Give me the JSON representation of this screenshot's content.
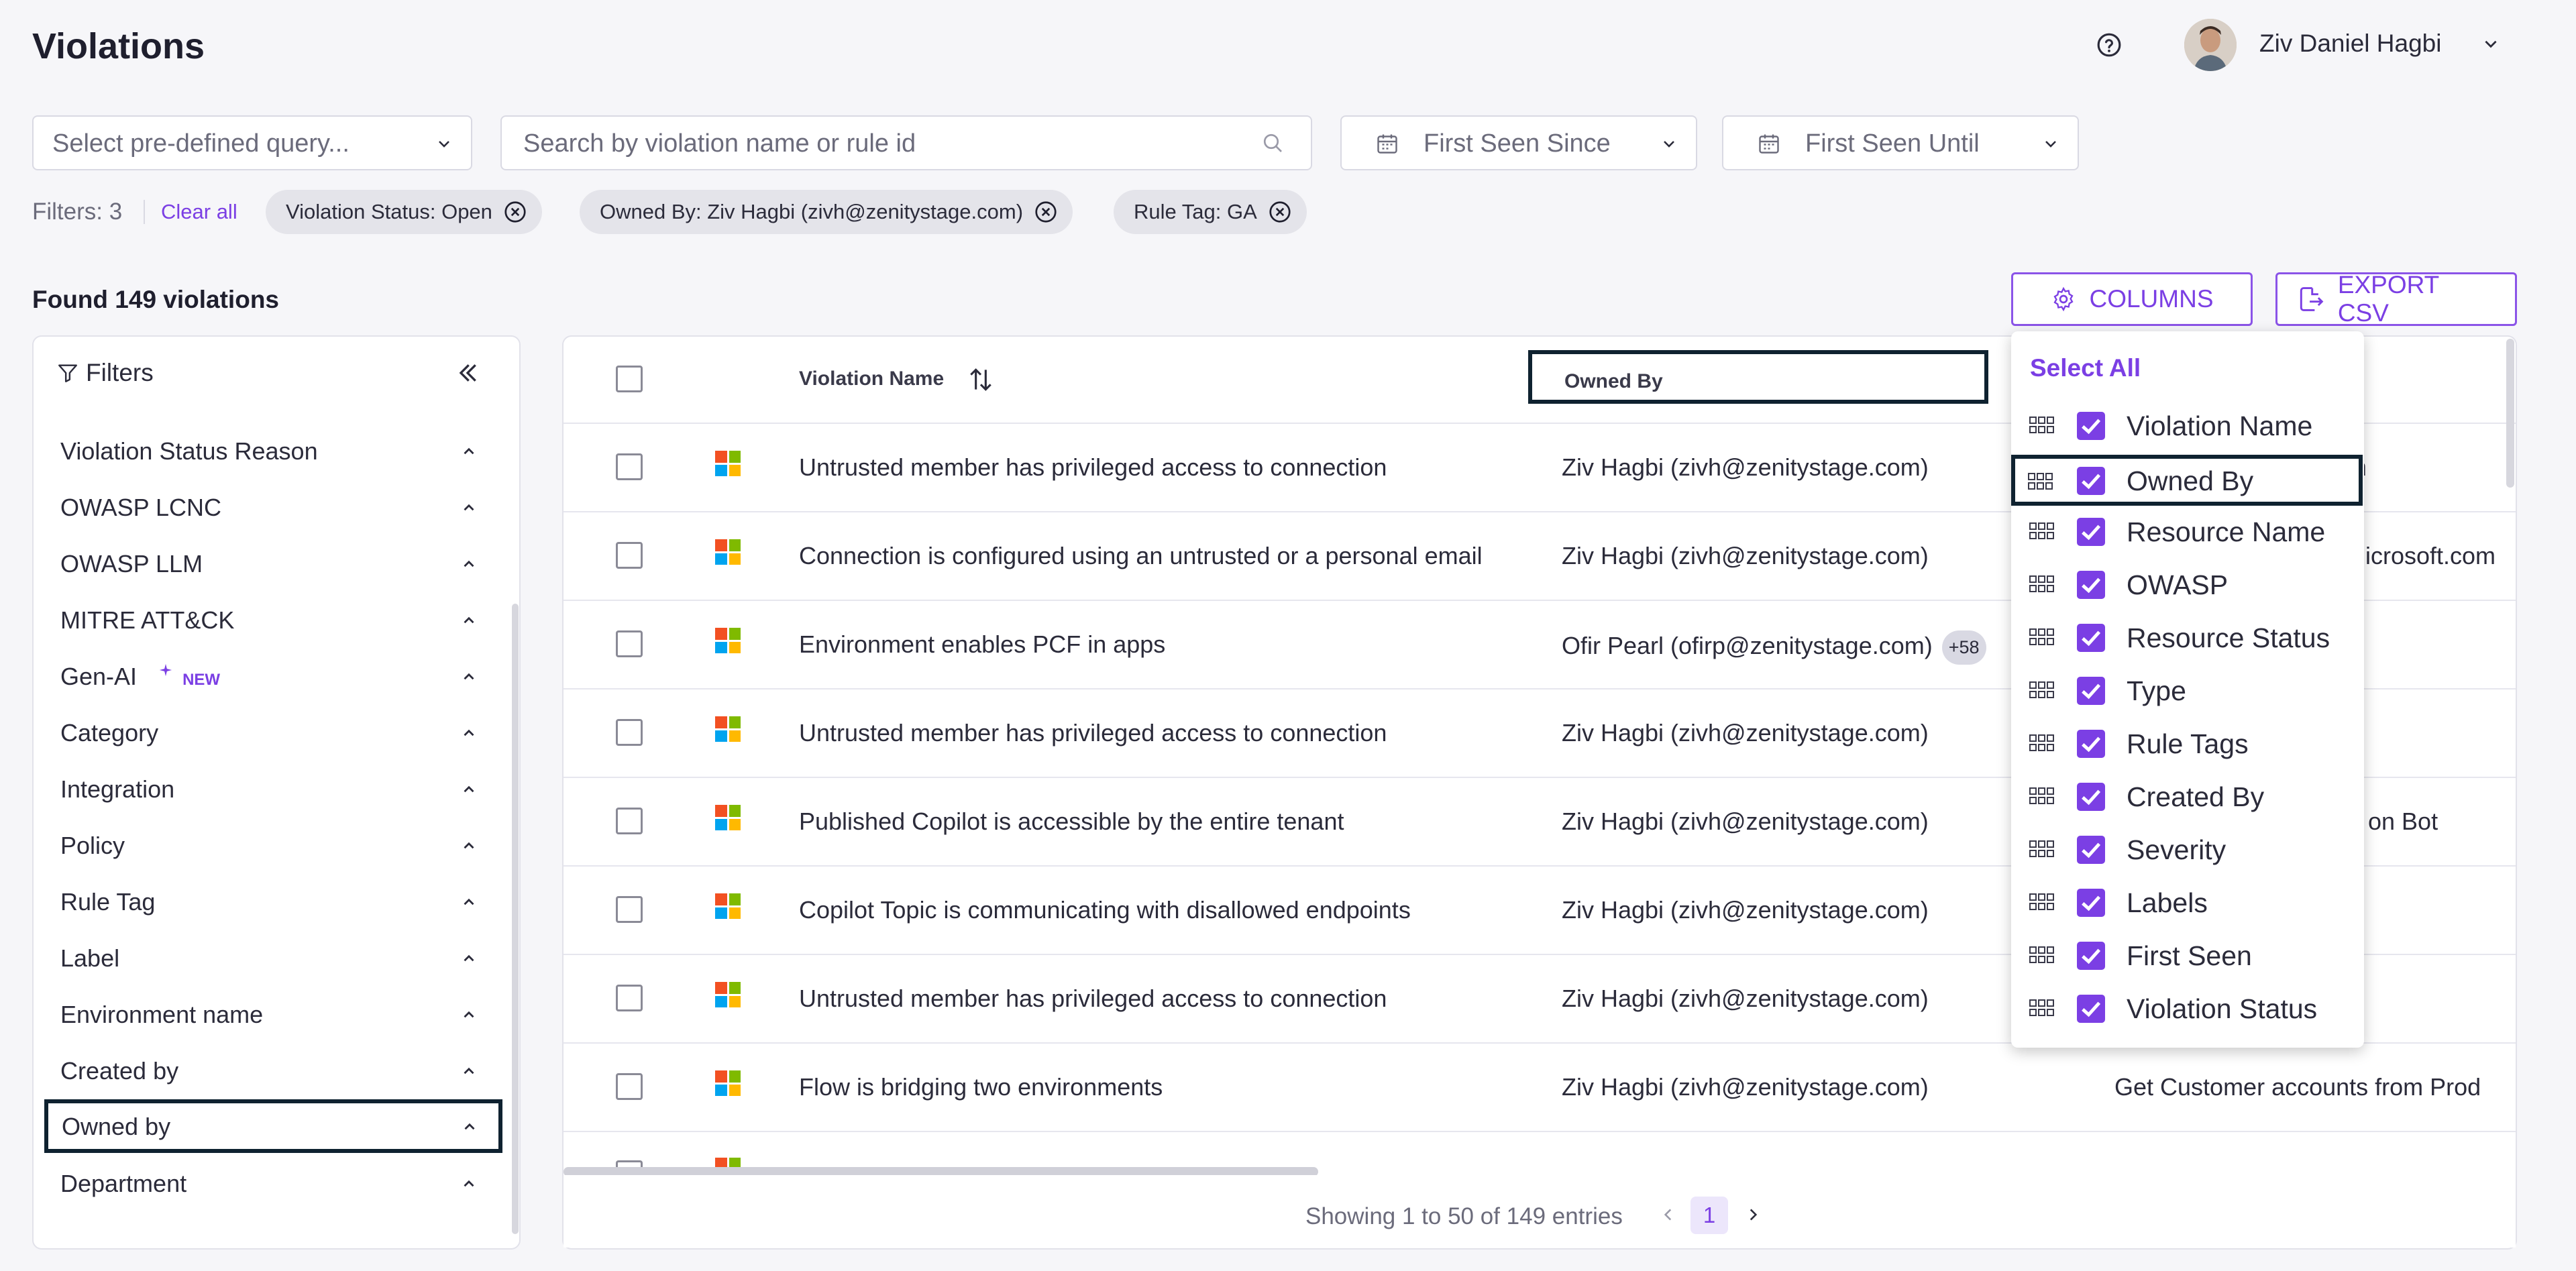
{
  "header": {
    "title": "Violations",
    "user_name": "Ziv Daniel Hagbi"
  },
  "controls": {
    "predefined_placeholder": "Select pre-defined query...",
    "search_placeholder": "Search by violation name or rule id",
    "first_seen_since": "First Seen Since",
    "first_seen_until": "First Seen Until"
  },
  "filters_bar": {
    "count_label": "Filters: 3",
    "clear_all": "Clear all",
    "chips": [
      "Violation Status: Open",
      "Owned By: Ziv Hagbi (zivh@zenitystage.com)",
      "Rule Tag: GA"
    ]
  },
  "results": {
    "found_label": "Found 149 violations",
    "columns_button": "COLUMNS",
    "export_button": "EXPORT CSV"
  },
  "filter_panel": {
    "title": "Filters",
    "new_badge": "NEW",
    "items": [
      "Violation Status Reason",
      "OWASP LCNC",
      "OWASP LLM",
      "MITRE ATT&CK",
      "Gen-AI",
      "Category",
      "Integration",
      "Policy",
      "Rule Tag",
      "Label",
      "Environment name",
      "Created by",
      "Owned by",
      "Department"
    ]
  },
  "table": {
    "headers": {
      "violation_name": "Violation Name",
      "owned_by": "Owned By"
    },
    "rows": [
      {
        "name": "Untrusted member has privileged access to connection",
        "owner": "Ziv Hagbi (zivh@zenitystage.com)",
        "extra": "m"
      },
      {
        "name": "Connection is configured using an untrusted or a personal email",
        "owner": "Ziv Hagbi (zivh@zenitystage.com)",
        "extra": "icrosoft.com"
      },
      {
        "name": "Environment enables PCF in apps",
        "owner": "Ofir Pearl (ofirp@zenitystage.com)",
        "badge": "+58",
        "extra": ""
      },
      {
        "name": "Untrusted member has privileged access to connection",
        "owner": "Ziv Hagbi (zivh@zenitystage.com)",
        "extra": ""
      },
      {
        "name": "Published Copilot is accessible by the entire tenant",
        "owner": "Ziv Hagbi (zivh@zenitystage.com)",
        "extra": "on Bot"
      },
      {
        "name": "Copilot Topic is communicating with disallowed endpoints",
        "owner": "Ziv Hagbi (zivh@zenitystage.com)",
        "extra": ""
      },
      {
        "name": "Untrusted member has privileged access to connection",
        "owner": "Ziv Hagbi (zivh@zenitystage.com)",
        "extra": ""
      },
      {
        "name": "Flow is bridging two environments",
        "owner": "Ziv Hagbi (zivh@zenitystage.com)",
        "extra": "Get Customer accounts from Prod"
      }
    ],
    "footer": "Showing 1 to 50 of 149 entries",
    "page": "1"
  },
  "columns_popup": {
    "select_all": "Select All",
    "items": [
      "Violation Name",
      "Owned By",
      "Resource Name",
      "OWASP",
      "Resource Status",
      "Type",
      "Rule Tags",
      "Created By",
      "Severity",
      "Labels",
      "First Seen",
      "Violation Status"
    ]
  },
  "colors": {
    "accent": "#7b3fe4",
    "highlight_border": "#0f2230",
    "ms_red": "#f25022",
    "ms_green": "#7fba00",
    "ms_blue": "#00a4ef",
    "ms_yellow": "#ffb900"
  }
}
